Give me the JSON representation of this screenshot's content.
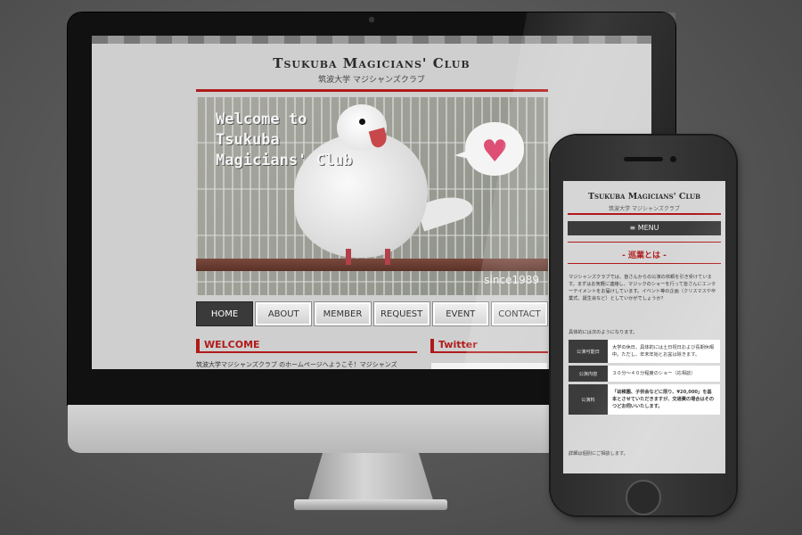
{
  "desktop": {
    "logo": "Tsukuba Magicians' Club",
    "subtitle": "筑波大学 マジシャンズクラブ",
    "hero": {
      "welcome_text": "Welcome to Tsukuba Magicians' Club",
      "since": "since1989"
    },
    "nav": [
      {
        "label": "HOME",
        "active": true
      },
      {
        "label": "ABOUT",
        "active": false
      },
      {
        "label": "MEMBER",
        "active": false
      },
      {
        "label": "REQUEST",
        "active": false
      },
      {
        "label": "EVENT",
        "active": false
      },
      {
        "label": "CONTACT",
        "active": false
      }
    ],
    "welcome_heading": "WELCOME",
    "twitter_heading": "Twitter",
    "body_text": "筑波大学マジシャンズクラブ のホームページへようこそ！マジシャンズ"
  },
  "mobile": {
    "logo": "Tsukuba Magicians' Club",
    "subtitle": "筑波大学 マジシャンズクラブ",
    "menu_label": "≡ MENU",
    "heading": "- 巡業とは -",
    "paragraph": "マジシャンズクラブでは、皆さんからの公演の依頼を引き受けています。まずはお気軽に連絡し、マジックのショーを行って皆さんにエンターテイメントをお届けしています。イベント等の企画（クリスマスや卒業式、誕生会など）としていかがでしょうか？",
    "note1": "具体的には次のようになります。",
    "table": [
      {
        "header": "公演可能日",
        "value": "大学の休日、具体的には土日祝日および長期休暇中。ただし、年末年始とお盆は除きます。",
        "bold": false
      },
      {
        "header": "公演内容",
        "value": "３０分～４０分程度のショー（応相談）",
        "bold": false
      },
      {
        "header": "公演料",
        "value": "「幼稚園、子供会などに限り、¥20,000」を基本とさせていただきますが、交通費の場合はそのつどお伺いいたします。",
        "bold": true
      }
    ],
    "note2": "詳細は個別にご相談します。"
  },
  "colors": {
    "accent_red": "#b01a1a",
    "nav_active": "#3a3a3a",
    "heart_pink": "#dd4f74"
  }
}
